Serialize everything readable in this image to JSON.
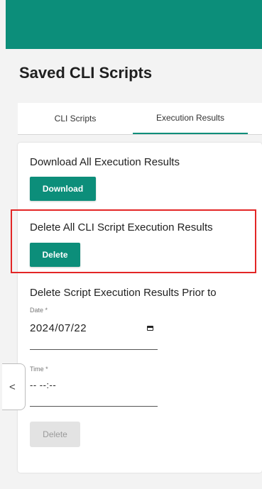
{
  "header": {
    "title": "Saved CLI Scripts",
    "accent_color": "#0c8e7a"
  },
  "tabs": [
    {
      "label": "CLI Scripts",
      "active": false
    },
    {
      "label": "Execution Results",
      "active": true
    }
  ],
  "download_section": {
    "label": "Download All Execution Results",
    "button_label": "Download"
  },
  "delete_all_section": {
    "label": "Delete All CLI Script Execution Results",
    "button_label": "Delete",
    "highlight_color": "#e32626"
  },
  "delete_prior_section": {
    "label": "Delete Script Execution Results Prior to",
    "date_label": "Date *",
    "date_value": "2024/07/22",
    "time_label": "Time *",
    "time_value": "-- --:--",
    "button_label": "Delete",
    "button_disabled": true
  },
  "side_toggle": {
    "icon": "chevron-left-icon",
    "glyph": "<"
  }
}
